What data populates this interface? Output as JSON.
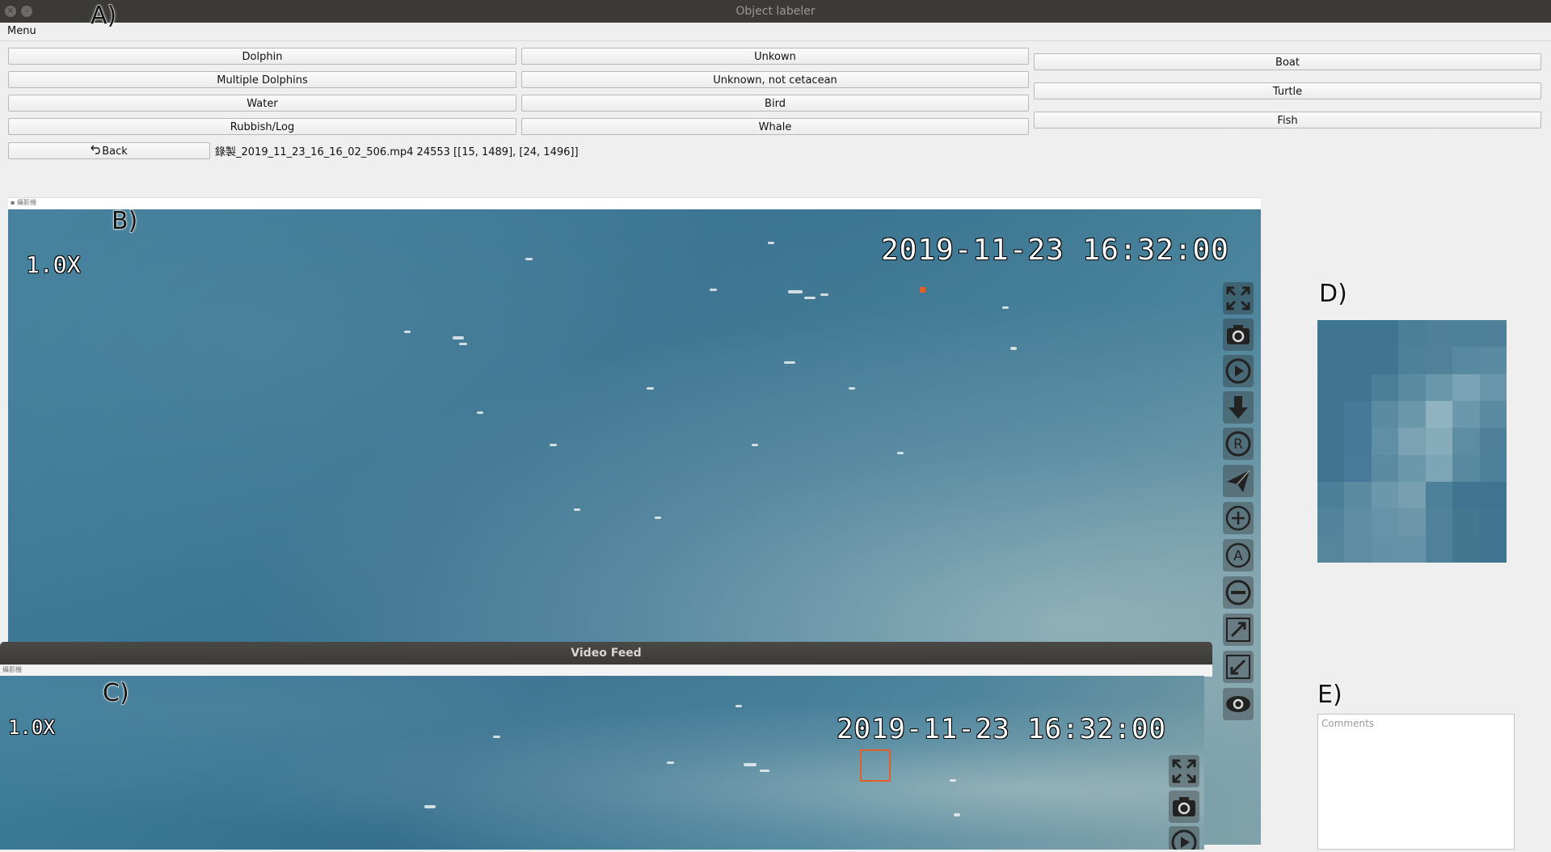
{
  "window": {
    "title": "Object labeler",
    "close_glyph": "×",
    "minimize_glyph": "–"
  },
  "menu": {
    "label": "Menu"
  },
  "annotations": {
    "a": "A)",
    "b": "B)",
    "c": "C)",
    "d": "D)",
    "e": "E)"
  },
  "labels": {
    "col1": [
      "Dolphin",
      "Multiple Dolphins",
      "Water",
      "Rubbish/Log"
    ],
    "col2": [
      "Unkown",
      "Unknown, not cetacean",
      "Bird",
      "Whale"
    ],
    "col3": [
      "Boat",
      "Turtle",
      "Fish"
    ]
  },
  "back_button": {
    "label": "Back",
    "icon": "back-arrow-icon"
  },
  "info": "錄製_2019_11_23_16_16_02_506.mp4 24553 [[15, 1489], [24, 1496]]",
  "main_video": {
    "zoom": "1.0X",
    "timestamp": "2019-11-23 16:32:00",
    "tools": [
      "fullscreen-icon",
      "camera-icon",
      "play-icon",
      "download-icon",
      "record-icon",
      "send-icon",
      "zoom-in-icon",
      "auto-icon",
      "zoom-out-icon",
      "expand-icon",
      "shrink-icon",
      "eye-icon"
    ]
  },
  "feed": {
    "title": "Video Feed",
    "zoom": "1.0X",
    "timestamp": "2019-11-23 16:32:00"
  },
  "comments": {
    "placeholder": "Comments",
    "value": ""
  },
  "colors": {
    "titlebar": "#3b3a37",
    "ocean": "#3d7d9a",
    "highlight": "#e0602a"
  }
}
